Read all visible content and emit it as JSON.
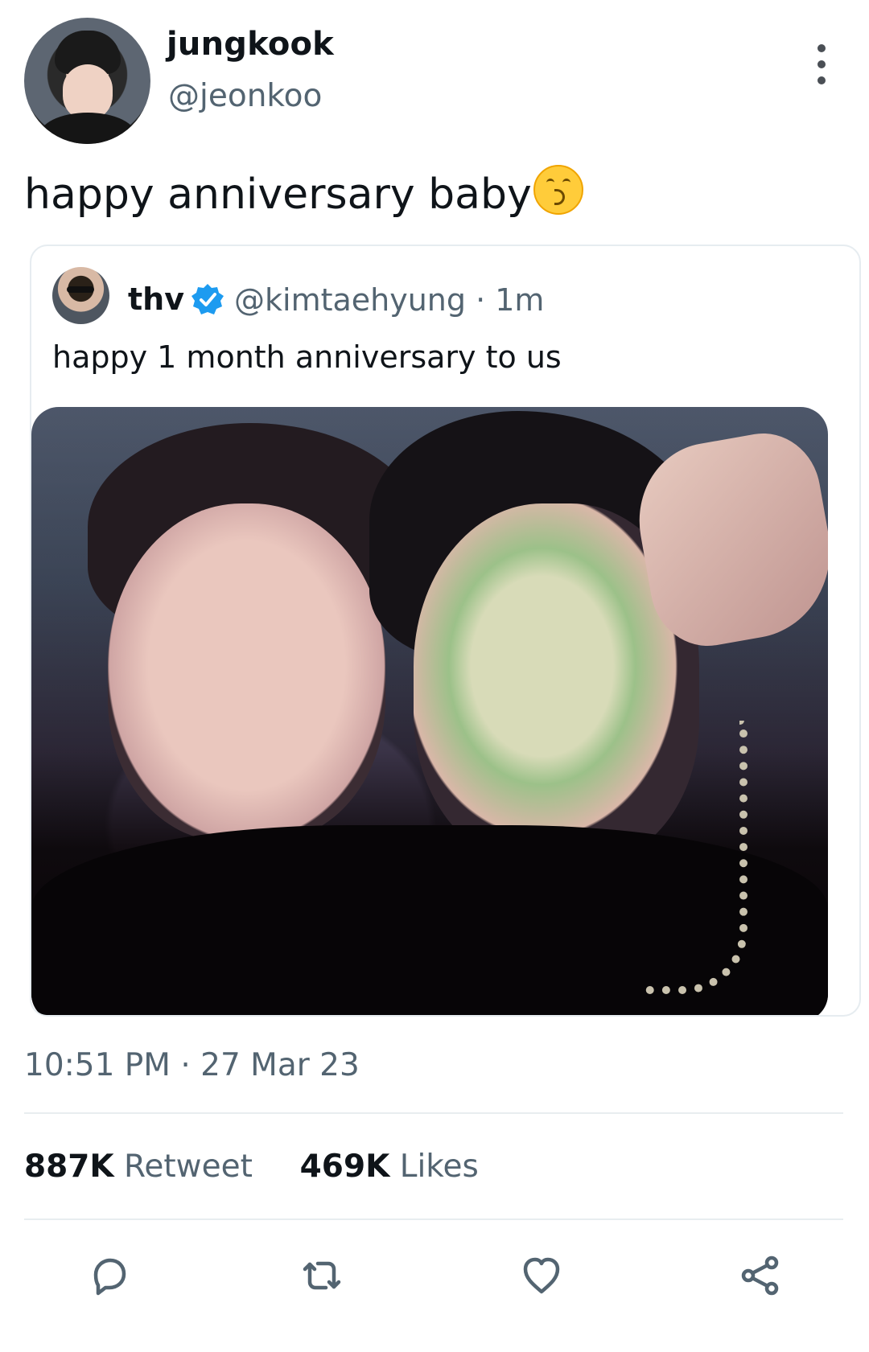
{
  "tweet": {
    "author": {
      "display_name": "jungkook",
      "handle": "@jeonkoo"
    },
    "text": "happy anniversary baby",
    "emoji": "kissing-face-with-smiling-eyes",
    "timestamp": "10:51 PM · 27 Mar 23",
    "stats": {
      "retweets_count": "887K",
      "retweets_label": "Retweet",
      "likes_count": "469K",
      "likes_label": "Likes"
    }
  },
  "quoted_tweet": {
    "author": {
      "display_name": "thv",
      "handle_time": "@kimtaehyung · 1m",
      "verified": true
    },
    "text": "happy 1 month anniversary to us"
  },
  "icons": {
    "more": "more-vertical-icon",
    "verified": "verified-badge-icon",
    "reply": "reply-icon",
    "retweet": "retweet-icon",
    "like": "heart-icon",
    "share": "share-icon"
  },
  "colors": {
    "primary_text": "#0f1419",
    "secondary_text": "#536471",
    "verified": "#1d9bf0",
    "divider": "#e8edf0"
  }
}
